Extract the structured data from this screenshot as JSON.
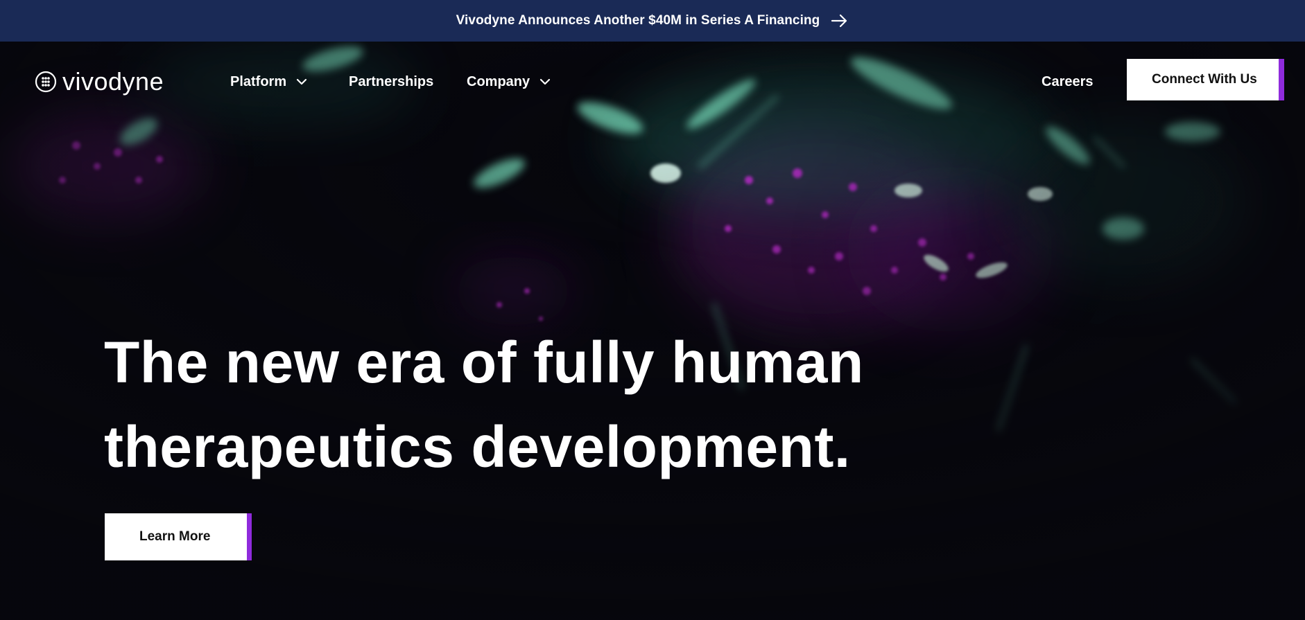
{
  "banner": {
    "text": "Vivodyne Announces Another $40M in Series A Financing",
    "arrow_icon": "arrow-right-icon"
  },
  "brand": {
    "name": "vivodyne",
    "logo_icon": "vivodyne-logo-mark-icon"
  },
  "nav": {
    "items": [
      {
        "label": "Platform",
        "has_dropdown": true
      },
      {
        "label": "Partnerships",
        "has_dropdown": false
      },
      {
        "label": "Company",
        "has_dropdown": true
      }
    ],
    "careers_label": "Careers",
    "cta_label": "Connect With Us"
  },
  "hero": {
    "headline_line1": "The new era of fully human",
    "headline_line2": "therapeutics development.",
    "button_label": "Learn More"
  },
  "colors": {
    "banner_bg": "#1a2a56",
    "hero_bg": "#07070d",
    "accent_purple": "#8f2bdc",
    "cell_green": "#7de8c4",
    "cell_magenta": "#b526c9"
  }
}
